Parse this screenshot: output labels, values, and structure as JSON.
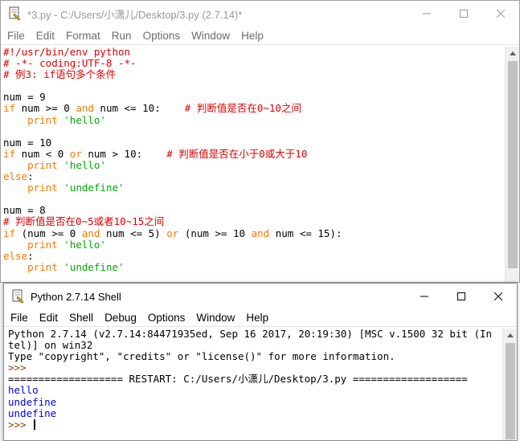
{
  "editor": {
    "title": "*3.py - C:/Users/小潇儿/Desktop/3.py (2.7.14)*",
    "menu": [
      "File",
      "Edit",
      "Format",
      "Run",
      "Options",
      "Window",
      "Help"
    ],
    "lines": [
      [
        {
          "t": "#!/usr/bin/env python",
          "c": "comment"
        }
      ],
      [
        {
          "t": "# -*- coding:UTF-8 -*-",
          "c": "comment"
        }
      ],
      [
        {
          "t": "# 例3: if语句多个条件",
          "c": "comment"
        }
      ],
      [
        {
          "t": "",
          "c": "def"
        }
      ],
      [
        {
          "t": "num = 9",
          "c": "def"
        }
      ],
      [
        {
          "t": "if",
          "c": "kw"
        },
        {
          "t": " num >= 0 ",
          "c": "def"
        },
        {
          "t": "and",
          "c": "kw"
        },
        {
          "t": " num <= 10:    ",
          "c": "def"
        },
        {
          "t": "# 判断值是否在0~10之间",
          "c": "comment"
        }
      ],
      [
        {
          "t": "    ",
          "c": "def"
        },
        {
          "t": "print",
          "c": "kw"
        },
        {
          "t": " ",
          "c": "def"
        },
        {
          "t": "'hello'",
          "c": "str"
        }
      ],
      [
        {
          "t": "",
          "c": "def"
        }
      ],
      [
        {
          "t": "num = 10",
          "c": "def"
        }
      ],
      [
        {
          "t": "if",
          "c": "kw"
        },
        {
          "t": " num < 0 ",
          "c": "def"
        },
        {
          "t": "or",
          "c": "kw"
        },
        {
          "t": " num > 10:    ",
          "c": "def"
        },
        {
          "t": "# 判断值是否在小于0或大于10",
          "c": "comment"
        }
      ],
      [
        {
          "t": "    ",
          "c": "def"
        },
        {
          "t": "print",
          "c": "kw"
        },
        {
          "t": " ",
          "c": "def"
        },
        {
          "t": "'hello'",
          "c": "str"
        }
      ],
      [
        {
          "t": "else",
          "c": "kw"
        },
        {
          "t": ":",
          "c": "def"
        }
      ],
      [
        {
          "t": "    ",
          "c": "def"
        },
        {
          "t": "print",
          "c": "kw"
        },
        {
          "t": " ",
          "c": "def"
        },
        {
          "t": "'undefine'",
          "c": "str"
        }
      ],
      [
        {
          "t": "",
          "c": "def"
        }
      ],
      [
        {
          "t": "num = 8",
          "c": "def"
        }
      ],
      [
        {
          "t": "# 判断值是否在0~5或者10~15之间",
          "c": "comment"
        }
      ],
      [
        {
          "t": "if",
          "c": "kw"
        },
        {
          "t": " (num >= 0 ",
          "c": "def"
        },
        {
          "t": "and",
          "c": "kw"
        },
        {
          "t": " num <= 5) ",
          "c": "def"
        },
        {
          "t": "or",
          "c": "kw"
        },
        {
          "t": " (num >= 10 ",
          "c": "def"
        },
        {
          "t": "and",
          "c": "kw"
        },
        {
          "t": " num <= 15):",
          "c": "def"
        }
      ],
      [
        {
          "t": "    ",
          "c": "def"
        },
        {
          "t": "print",
          "c": "kw"
        },
        {
          "t": " ",
          "c": "def"
        },
        {
          "t": "'hello'",
          "c": "str"
        }
      ],
      [
        {
          "t": "else",
          "c": "kw"
        },
        {
          "t": ":",
          "c": "def"
        }
      ],
      [
        {
          "t": "    ",
          "c": "def"
        },
        {
          "t": "print",
          "c": "kw"
        },
        {
          "t": " ",
          "c": "def"
        },
        {
          "t": "'undefine'",
          "c": "str"
        }
      ]
    ]
  },
  "shell": {
    "title": "Python 2.7.14 Shell",
    "menu": [
      "File",
      "Edit",
      "Shell",
      "Debug",
      "Options",
      "Window",
      "Help"
    ],
    "lines": [
      [
        {
          "t": "Python 2.7.14 (v2.7.14:84471935ed, Sep 16 2017, 20:19:30) [MSC v.1500 32 bit (In",
          "c": "def"
        }
      ],
      [
        {
          "t": "tel)] on win32",
          "c": "def"
        }
      ],
      [
        {
          "t": "Type \"copyright\", \"credits\" or \"license()\" for more information.",
          "c": "def"
        }
      ],
      [
        {
          "t": ">>> ",
          "c": "prompt"
        }
      ],
      [
        {
          "t": "=================== RESTART: C:/Users/小潇儿/Desktop/3.py ===================",
          "c": "restart"
        }
      ],
      [
        {
          "t": "hello",
          "c": "out"
        }
      ],
      [
        {
          "t": "undefine",
          "c": "out"
        }
      ],
      [
        {
          "t": "undefine",
          "c": "out"
        }
      ]
    ],
    "prompt": ">>> "
  },
  "colors": {
    "comment": "#dd0000",
    "keyword": "#ff7700",
    "string": "#00aa00",
    "output": "#0000ee",
    "prompt": "#8b4513"
  }
}
